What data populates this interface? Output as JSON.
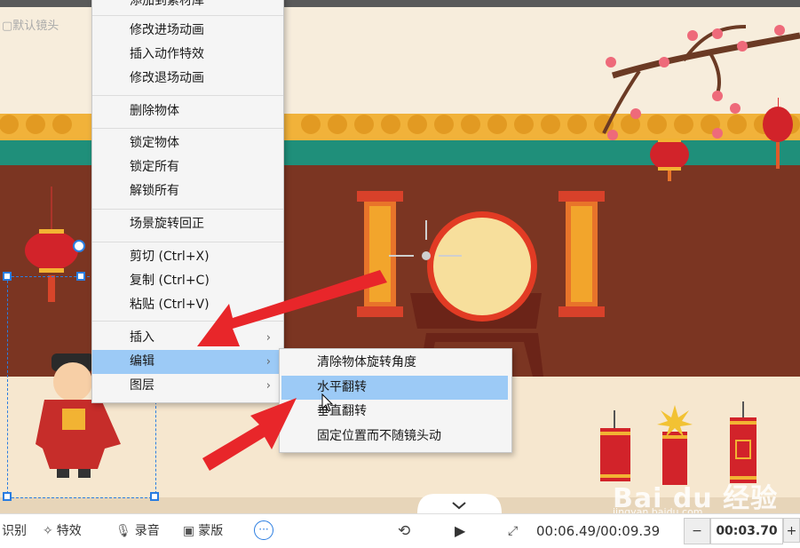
{
  "canvas": {
    "camera_label": "默认镜头",
    "watermark_main": "Bai du 经验",
    "watermark_sub": "jingyan.baidu.com"
  },
  "context_menu": {
    "items": [
      {
        "label": "添加到素材库",
        "partial": true
      },
      {
        "label": "修改进场动画"
      },
      {
        "label": "插入动作特效"
      },
      {
        "label": "修改退场动画"
      },
      {
        "label": "删除物体"
      },
      {
        "label": "锁定物体"
      },
      {
        "label": "锁定所有"
      },
      {
        "label": "解锁所有"
      },
      {
        "label": "场景旋转回正"
      },
      {
        "label": "剪切 (Ctrl+X)"
      },
      {
        "label": "复制 (Ctrl+C)"
      },
      {
        "label": "粘贴 (Ctrl+V)"
      },
      {
        "label": "插入",
        "submenu": true
      },
      {
        "label": "编辑",
        "submenu": true,
        "highlighted": true
      },
      {
        "label": "图层",
        "submenu": true
      }
    ]
  },
  "submenu": {
    "items": [
      {
        "label": "清除物体旋转角度"
      },
      {
        "label": "水平翻转",
        "highlighted": true
      },
      {
        "label": "垂直翻转"
      },
      {
        "label": "固定位置而不随镜头动"
      }
    ]
  },
  "bottom_bar": {
    "tool_partial": "识别",
    "effects": "特效",
    "record": "录音",
    "mask": "蒙版",
    "time": "00:06.49/00:09.39",
    "duration": "00:03.70",
    "minus": "−",
    "plus": "+"
  },
  "colors": {
    "wall": "#7b3522",
    "ground": "#f6e7cf",
    "teal": "#1f8f7a",
    "roof": "#f3b63b",
    "highlight": "#9ccaf6",
    "arrow": "#e8262a",
    "selection": "#2a7de1"
  }
}
